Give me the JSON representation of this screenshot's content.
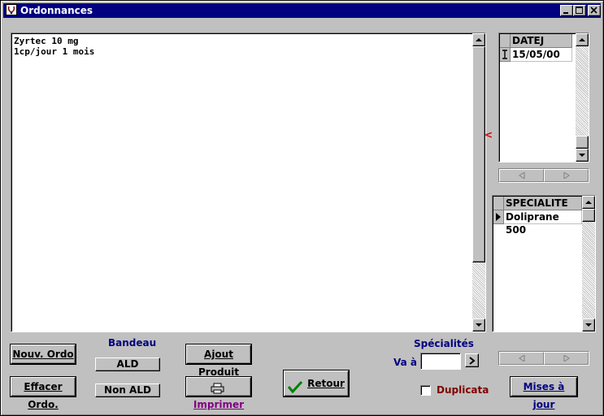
{
  "window": {
    "title": "Ordonnances"
  },
  "memo": {
    "lines": "Zyrtec 10 mg\n1cp/jour 1 mois"
  },
  "splitter": {
    "glyph": "<"
  },
  "date_grid": {
    "header": "DATEJ",
    "rows": [
      "15/05/00"
    ]
  },
  "spec_grid": {
    "header": "SPECIALITE",
    "rows": [
      "Doliprane 500"
    ]
  },
  "buttons": {
    "nouv_ordo": "Nouv. Ordo",
    "effacer_ordo": "Effacer Ordo.",
    "ald": "ALD",
    "non_ald": "Non ALD",
    "ajout_produit": "Ajout Produit",
    "imprimer": "Imprimer",
    "retour": "Retour",
    "mises_a_jour": "Mises à jour"
  },
  "labels": {
    "bandeau": "Bandeau",
    "specialites": "Spécialités",
    "va_a": "Va à",
    "duplicata": "Duplicata"
  },
  "va_a_input": {
    "value": ""
  },
  "duplicata": {
    "checked": false
  },
  "colors": {
    "title_bar": "#000080",
    "label_blue": "#000080",
    "imprimer_purple": "#800080",
    "duplicata_red": "#800000"
  }
}
